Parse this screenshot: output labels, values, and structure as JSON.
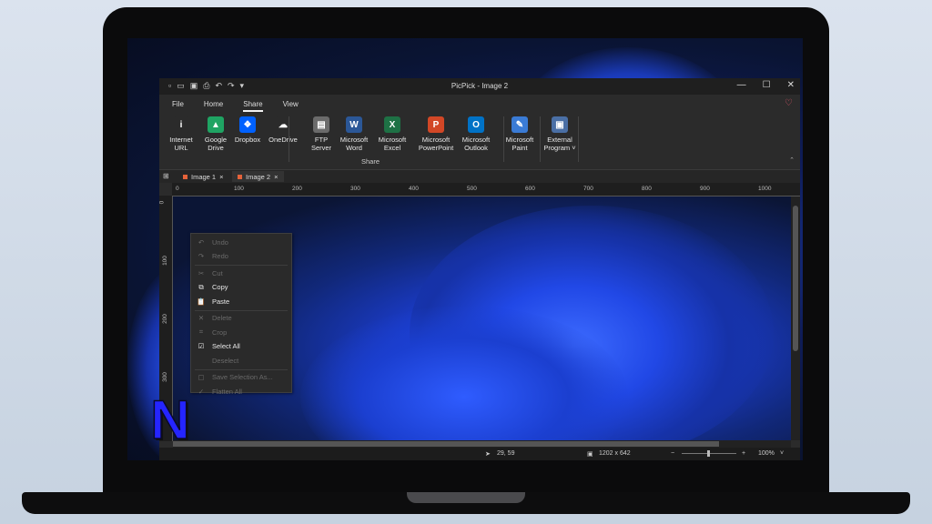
{
  "window": {
    "title": "PicPick - Image 2"
  },
  "qat": {
    "icons": [
      "new-file-icon",
      "open-folder-icon",
      "save-icon",
      "print-icon",
      "undo-icon",
      "redo-icon",
      "dropdown-icon"
    ]
  },
  "window_controls": {
    "minimize": "—",
    "maximize": "☐",
    "close": "✕"
  },
  "menu_tabs": [
    "File",
    "Home",
    "Share",
    "View"
  ],
  "ribbon": {
    "group_label": "Share",
    "buttons": [
      {
        "label1": "Internet",
        "label2": "URL",
        "glyph": "i",
        "color": "#2b2b2b"
      },
      {
        "label1": "Google",
        "label2": "Drive",
        "glyph": "▲",
        "color": "#1fa463"
      },
      {
        "label1": "Dropbox",
        "label2": "",
        "glyph": "❖",
        "color": "#0061fe"
      },
      {
        "label1": "OneDrive",
        "label2": "",
        "glyph": "☁",
        "color": "#2b2b2b"
      },
      {
        "label1": "FTP",
        "label2": "Server",
        "glyph": "▤",
        "color": "#6b6b6b"
      },
      {
        "label1": "Microsoft",
        "label2": "Word",
        "glyph": "W",
        "color": "#2b5797"
      },
      {
        "label1": "Microsoft",
        "label2": "Excel",
        "glyph": "X",
        "color": "#1e7145"
      },
      {
        "label1": "Microsoft",
        "label2": "PowerPoint",
        "glyph": "P",
        "color": "#d24726"
      },
      {
        "label1": "Microsoft",
        "label2": "Outlook",
        "glyph": "O",
        "color": "#0072c6"
      },
      {
        "label1": "Microsoft",
        "label2": "Paint",
        "glyph": "✎",
        "color": "#3a7bd5"
      },
      {
        "label1": "External",
        "label2": "Program ˅",
        "glyph": "▣",
        "color": "#4a6fa5"
      }
    ]
  },
  "doc_tabs": [
    {
      "label": "Image 1",
      "close": "×"
    },
    {
      "label": "Image 2",
      "close": "×"
    }
  ],
  "ruler": {
    "h": [
      "0",
      "100",
      "200",
      "300",
      "400",
      "500",
      "600",
      "700",
      "800",
      "900",
      "1000"
    ],
    "v": [
      "0",
      "100",
      "200",
      "300"
    ]
  },
  "context_menu": [
    {
      "label": "Undo",
      "icon": "↶",
      "enabled": false
    },
    {
      "label": "Redo",
      "icon": "↷",
      "enabled": false
    },
    {
      "sep": true
    },
    {
      "label": "Cut",
      "icon": "✂",
      "enabled": false
    },
    {
      "label": "Copy",
      "icon": "⧉",
      "enabled": true
    },
    {
      "label": "Paste",
      "icon": "📋",
      "enabled": true
    },
    {
      "sep": true
    },
    {
      "label": "Delete",
      "icon": "✕",
      "enabled": false
    },
    {
      "label": "Crop",
      "icon": "⌗",
      "enabled": false
    },
    {
      "label": "Select All",
      "icon": "☑",
      "enabled": true
    },
    {
      "label": "Deselect",
      "icon": "",
      "enabled": false
    },
    {
      "sep": true
    },
    {
      "label": "Save Selection As...",
      "icon": "▢",
      "enabled": false
    },
    {
      "label": "Flatten All",
      "icon": "✓",
      "enabled": false
    }
  ],
  "status": {
    "cursor": "29, 59",
    "size": "1202 x 642",
    "zoom": "100%",
    "minus": "−",
    "plus": "+"
  },
  "badge": {
    "letter": "N"
  }
}
